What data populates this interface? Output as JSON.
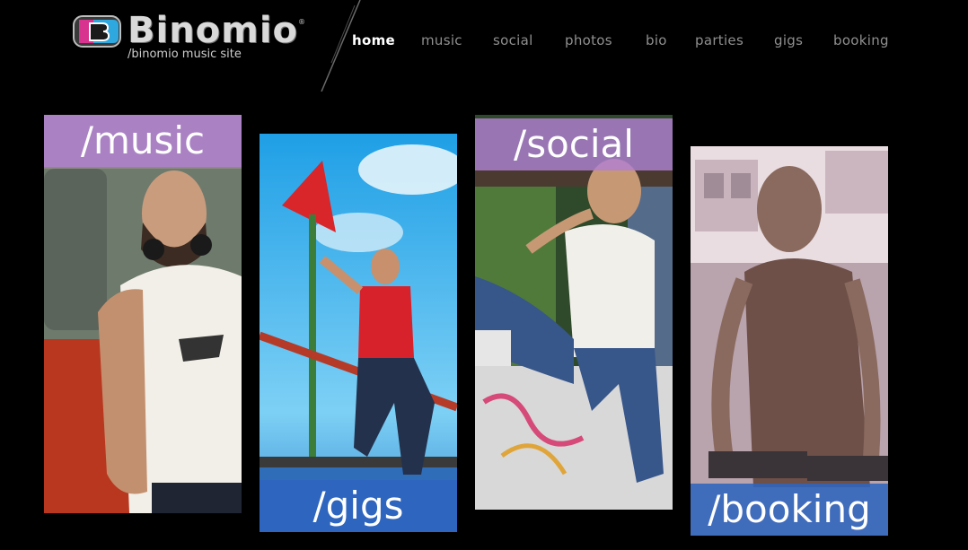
{
  "logo": {
    "wordmark": "Binomio",
    "registered": "®",
    "tagline": "/binomio music site",
    "mark_icon": "binomio-b-logo",
    "colors": {
      "blue": "#2fa8e0",
      "magenta": "#d8338f",
      "gray": "#d9d9d9"
    }
  },
  "nav": {
    "items": [
      {
        "label": "home",
        "active": true
      },
      {
        "label": "music",
        "active": false
      },
      {
        "label": "social",
        "active": false
      },
      {
        "label": "photos",
        "active": false
      },
      {
        "label": "bio",
        "active": false
      },
      {
        "label": "parties",
        "active": false
      },
      {
        "label": "gigs",
        "active": false
      },
      {
        "label": "booking",
        "active": false
      }
    ]
  },
  "panels": {
    "music": {
      "label": "/music",
      "label_color": "#b180d2"
    },
    "gigs": {
      "label": "/gigs",
      "label_color": "#2f64be"
    },
    "social": {
      "label": "/social",
      "label_color": "#b180d2"
    },
    "booking": {
      "label": "/booking",
      "label_color": "#2f64be"
    }
  },
  "theme": {
    "background": "#000000",
    "nav_active": "#ffffff",
    "nav_inactive": "#8f8f8f"
  }
}
